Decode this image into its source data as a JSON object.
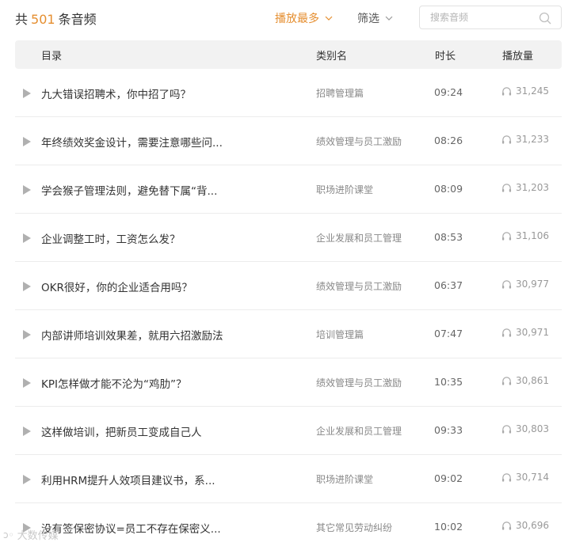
{
  "header": {
    "count_prefix": "共",
    "count_value": "501",
    "count_suffix": "条音频",
    "sort_label": "播放最多",
    "filter_label": "筛选",
    "search_placeholder": "搜索音频"
  },
  "columns": {
    "title": "目录",
    "category": "类别名",
    "duration": "时长",
    "plays": "播放量"
  },
  "rows": [
    {
      "title": "九大错误招聘术，你中招了吗？",
      "category": "招聘管理篇",
      "duration": "09:24",
      "plays": "31,245"
    },
    {
      "title": "年终绩效奖金设计，需要注意哪些问...",
      "category": "绩效管理与员工激励",
      "duration": "08:26",
      "plays": "31,233"
    },
    {
      "title": "学会猴子管理法则，避免替下属“背...",
      "category": "职场进阶课堂",
      "duration": "08:09",
      "plays": "31,203"
    },
    {
      "title": "企业调整工时，工资怎么发？",
      "category": "企业发展和员工管理",
      "duration": "08:53",
      "plays": "31,106"
    },
    {
      "title": "OKR很好，你的企业适合用吗？",
      "category": "绩效管理与员工激励",
      "duration": "06:37",
      "plays": "30,977"
    },
    {
      "title": "内部讲师培训效果差，就用六招激励法",
      "category": "培训管理篇",
      "duration": "07:47",
      "plays": "30,971"
    },
    {
      "title": "KPI怎样做才能不沦为“鸡肋”？",
      "category": "绩效管理与员工激励",
      "duration": "10:35",
      "plays": "30,861"
    },
    {
      "title": "这样做培训，把新员工变成自己人",
      "category": "企业发展和员工管理",
      "duration": "09:33",
      "plays": "30,803"
    },
    {
      "title": "利用HRM提升人效项目建议书，系...",
      "category": "职场进阶课堂",
      "duration": "09:02",
      "plays": "30,714"
    },
    {
      "title": "没有签保密协议=员工不存在保密义...",
      "category": "其它常见劳动纠纷",
      "duration": "10:02",
      "plays": "30,696"
    }
  ],
  "watermark": {
    "text": "大数传媒"
  },
  "colors": {
    "accent": "#e58e2f",
    "header_bg": "#f2f2f2",
    "icon_gray": "#b0b0b0"
  },
  "icons": {
    "sort": "chevron-down-icon",
    "filter": "chevron-down-icon",
    "search": "search-icon",
    "row_play": "play-icon",
    "row_plays": "headphones-icon"
  }
}
